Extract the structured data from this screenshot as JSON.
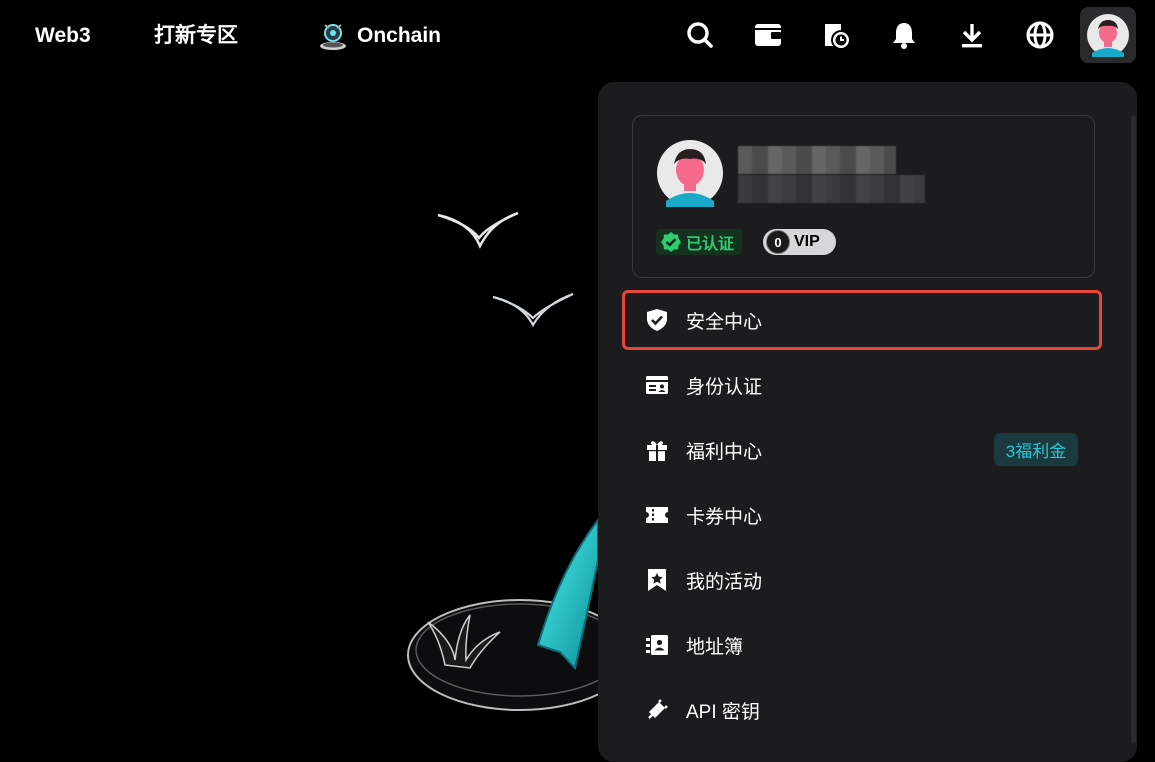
{
  "nav": {
    "web3": "Web3",
    "launchpad": "打新专区",
    "onchain": "Onchain"
  },
  "icons": [
    "search-icon",
    "wallet-icon",
    "order-history-icon",
    "bell-icon",
    "download-icon",
    "globe-icon",
    "avatar"
  ],
  "profile": {
    "verified_label": "已认证",
    "vip_level": "0",
    "vip_label": "VIP"
  },
  "menu": {
    "security": "安全中心",
    "identity": "身份认证",
    "rewards": "福利中心",
    "rewards_badge": "3福利金",
    "coupons": "卡券中心",
    "activities": "我的活动",
    "address_book": "地址簿",
    "api_keys": "API 密钥"
  },
  "colors": {
    "highlight_border": "#e8453c",
    "verified_green": "#2ecc71",
    "welfare_cyan": "#2bc7d6",
    "accent_teal": "#1fd1d8"
  }
}
